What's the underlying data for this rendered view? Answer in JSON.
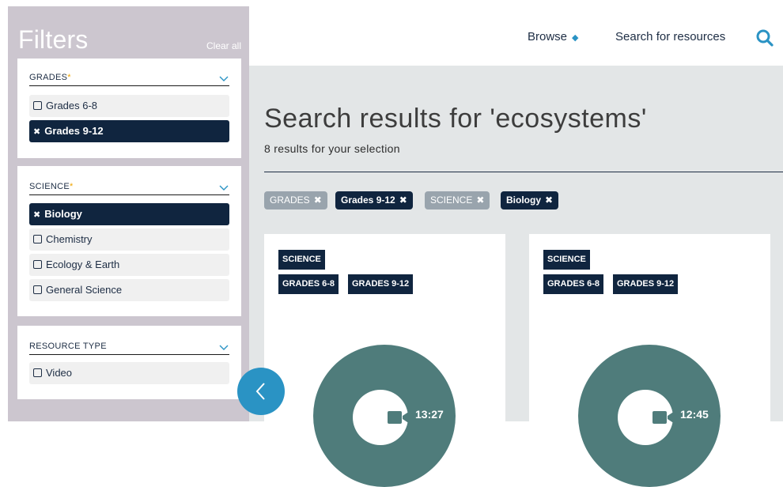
{
  "sidebar": {
    "title": "Filters",
    "clear_all": "Clear all",
    "groups": [
      {
        "label": "GRADES",
        "required": "*",
        "options": [
          {
            "label": "Grades 6-8",
            "selected": false
          },
          {
            "label": "Grades 9-12",
            "selected": true
          }
        ]
      },
      {
        "label": "SCIENCE",
        "required": "*",
        "options": [
          {
            "label": "Biology",
            "selected": true
          },
          {
            "label": "Chemistry",
            "selected": false
          },
          {
            "label": "Ecology & Earth",
            "selected": false
          },
          {
            "label": "General Science",
            "selected": false
          }
        ]
      },
      {
        "label": "RESOURCE TYPE",
        "required": "",
        "options": [
          {
            "label": "Video",
            "selected": false
          }
        ]
      }
    ]
  },
  "nav": {
    "browse": "Browse",
    "search": "Search for resources"
  },
  "main": {
    "heading": "Search results for 'ecosystems'",
    "subheading": "8 results for your selection",
    "active_filters": [
      {
        "label": "GRADES",
        "style": "grey"
      },
      {
        "label": "Grades 9-12",
        "style": "dark"
      },
      {
        "label": "SCIENCE",
        "style": "grey"
      },
      {
        "label": "Biology",
        "style": "dark"
      }
    ],
    "cards": [
      {
        "subject": "SCIENCE",
        "grades": [
          "GRADES 6-8",
          "GRADES 9-12"
        ],
        "duration": "13:27"
      },
      {
        "subject": "SCIENCE",
        "grades": [
          "GRADES 6-8",
          "GRADES 9-12"
        ],
        "duration": "12:45"
      }
    ]
  },
  "colors": {
    "sidebar_bg": "#ccc6cf",
    "navy": "#10253f",
    "accent_blue": "#2a93c4",
    "thumb_teal": "#4f7c7b",
    "required_star": "#f0a500"
  },
  "icons": {
    "browse_arrows": "sort-arrows-icon",
    "search": "search-icon",
    "filter_chevron": "chevron-down-icon",
    "chip_remove": "close-icon",
    "collapse": "chevron-left-icon",
    "thumb": "video-camera-icon"
  }
}
